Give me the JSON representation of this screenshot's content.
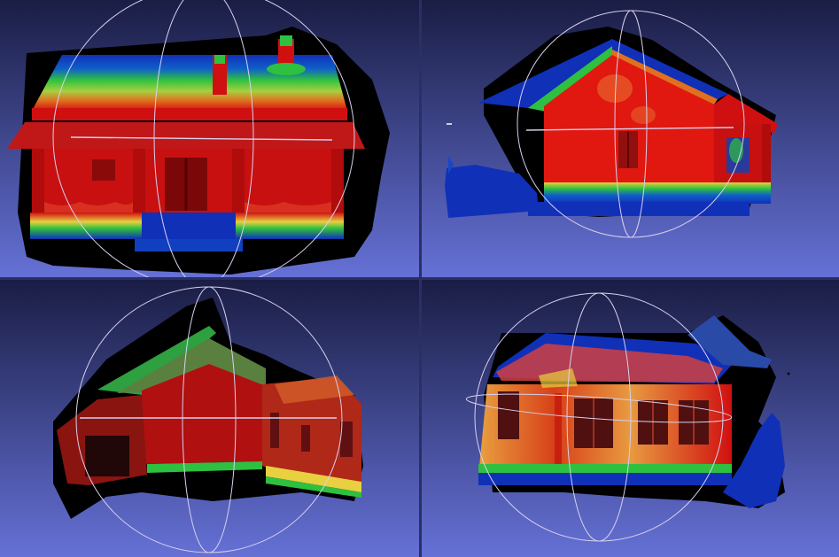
{
  "colors": {
    "bg_top": "#1a1d44",
    "bg_bottom": "#6571d6",
    "separator": "#2a2f66",
    "trackball": "#d8d0ee",
    "shadow": "#000000",
    "quality_high": "#d01010",
    "quality_mid": "#e8d040",
    "quality_green": "#2ec040",
    "quality_low": "#1030b8"
  },
  "icons": {
    "trackball": "trackball-gizmo-icon"
  }
}
